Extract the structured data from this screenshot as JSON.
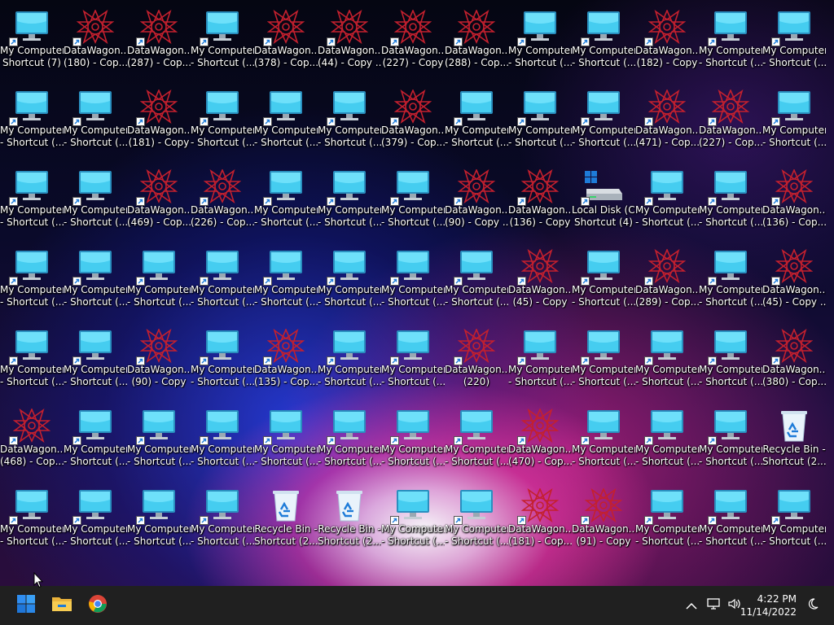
{
  "colors": {
    "taskbar": "#202020",
    "monitor": "#3cc4e8",
    "datawagon": "#c0202c",
    "accent": "#1e7bd8"
  },
  "desktop": {
    "icons": [
      {
        "type": "monitor",
        "line1": "My Computer",
        "line2": "Shortcut (7)",
        "shortcut": true
      },
      {
        "type": "datawagon",
        "line1": "DataWagon...",
        "line2": "(180) - Cop...",
        "shortcut": true
      },
      {
        "type": "datawagon",
        "line1": "DataWagon...",
        "line2": "(287) - Cop...",
        "shortcut": true
      },
      {
        "type": "monitor",
        "line1": "My Computer",
        "line2": "- Shortcut (...",
        "shortcut": true
      },
      {
        "type": "datawagon",
        "line1": "DataWagon...",
        "line2": "(378) - Cop...",
        "shortcut": true
      },
      {
        "type": "datawagon",
        "line1": "DataWagon...",
        "line2": "(44) - Copy ...",
        "shortcut": true
      },
      {
        "type": "datawagon",
        "line1": "DataWagon...",
        "line2": "(227) - Copy",
        "shortcut": true
      },
      {
        "type": "datawagon",
        "line1": "DataWagon...",
        "line2": "(288) - Cop...",
        "shortcut": true
      },
      {
        "type": "monitor",
        "line1": "My Computer",
        "line2": "- Shortcut (...",
        "shortcut": true
      },
      {
        "type": "monitor",
        "line1": "My Computer",
        "line2": "- Shortcut (...",
        "shortcut": true
      },
      {
        "type": "datawagon",
        "line1": "DataWagon...",
        "line2": "(182) - Copy",
        "shortcut": true
      },
      {
        "type": "monitor",
        "line1": "My Computer",
        "line2": "- Shortcut (...",
        "shortcut": true
      },
      {
        "type": "monitor",
        "line1": "My Computer",
        "line2": "- Shortcut (...",
        "shortcut": true
      },
      {
        "type": "monitor",
        "line1": "My Computer",
        "line2": "- Shortcut (...",
        "shortcut": true
      },
      {
        "type": "monitor",
        "line1": "My Computer",
        "line2": "- Shortcut (...",
        "shortcut": true
      },
      {
        "type": "datawagon",
        "line1": "DataWagon...",
        "line2": "(181) - Copy",
        "shortcut": true
      },
      {
        "type": "monitor",
        "line1": "My Computer",
        "line2": "- Shortcut (...",
        "shortcut": true
      },
      {
        "type": "monitor",
        "line1": "My Computer",
        "line2": "- Shortcut (...",
        "shortcut": true
      },
      {
        "type": "monitor",
        "line1": "My Computer",
        "line2": "- Shortcut (...",
        "shortcut": true
      },
      {
        "type": "datawagon",
        "line1": "DataWagon...",
        "line2": "(379) - Cop...",
        "shortcut": true
      },
      {
        "type": "monitor",
        "line1": "My Computer",
        "line2": "- Shortcut (...",
        "shortcut": true
      },
      {
        "type": "monitor",
        "line1": "My Computer",
        "line2": "- Shortcut (...",
        "shortcut": true
      },
      {
        "type": "monitor",
        "line1": "My Computer",
        "line2": "- Shortcut (...",
        "shortcut": true
      },
      {
        "type": "datawagon",
        "line1": "DataWagon...",
        "line2": "(471) - Cop...",
        "shortcut": true
      },
      {
        "type": "datawagon",
        "line1": "DataWagon...",
        "line2": "(227) - Cop...",
        "shortcut": true
      },
      {
        "type": "monitor",
        "line1": "My Computer",
        "line2": "- Shortcut (...",
        "shortcut": true
      },
      {
        "type": "monitor",
        "line1": "My Computer",
        "line2": "- Shortcut (...",
        "shortcut": true
      },
      {
        "type": "monitor",
        "line1": "My Computer",
        "line2": "- Shortcut (...",
        "shortcut": true
      },
      {
        "type": "datawagon",
        "line1": "DataWagon...",
        "line2": "(469) - Cop...",
        "shortcut": true
      },
      {
        "type": "datawagon",
        "line1": "DataWagon...",
        "line2": "(226) - Cop...",
        "shortcut": true
      },
      {
        "type": "monitor",
        "line1": "My Computer",
        "line2": "- Shortcut (...",
        "shortcut": true
      },
      {
        "type": "monitor",
        "line1": "My Computer",
        "line2": "- Shortcut (...",
        "shortcut": true
      },
      {
        "type": "monitor",
        "line1": "My Computer",
        "line2": "- Shortcut (...",
        "shortcut": true
      },
      {
        "type": "datawagon",
        "line1": "DataWagon...",
        "line2": "(90) - Copy ...",
        "shortcut": true
      },
      {
        "type": "datawagon",
        "line1": "DataWagon...",
        "line2": "(136) - Copy",
        "shortcut": true
      },
      {
        "type": "disk",
        "line1": "Local Disk (C)",
        "line2": "Shortcut (4)",
        "shortcut": true
      },
      {
        "type": "monitor",
        "line1": "My Computer",
        "line2": "- Shortcut (...",
        "shortcut": true
      },
      {
        "type": "monitor",
        "line1": "My Computer",
        "line2": "- Shortcut (...",
        "shortcut": true
      },
      {
        "type": "datawagon",
        "line1": "DataWagon...",
        "line2": "(136) - Cop...",
        "shortcut": true
      },
      {
        "type": "monitor",
        "line1": "My Computer",
        "line2": "- Shortcut (...",
        "shortcut": true
      },
      {
        "type": "monitor",
        "line1": "My Computer",
        "line2": "- Shortcut (...",
        "shortcut": true
      },
      {
        "type": "monitor",
        "line1": "My Computer",
        "line2": "- Shortcut (...",
        "shortcut": true
      },
      {
        "type": "monitor",
        "line1": "My Computer",
        "line2": "- Shortcut (...",
        "shortcut": true
      },
      {
        "type": "monitor",
        "line1": "My Computer",
        "line2": "- Shortcut (...",
        "shortcut": true
      },
      {
        "type": "monitor",
        "line1": "My Computer",
        "line2": "- Shortcut (...",
        "shortcut": true
      },
      {
        "type": "monitor",
        "line1": "My Computer",
        "line2": "- Shortcut (...",
        "shortcut": true
      },
      {
        "type": "monitor",
        "line1": "My Computer",
        "line2": "- Shortcut (...",
        "shortcut": true
      },
      {
        "type": "datawagon",
        "line1": "DataWagon...",
        "line2": "(45) - Copy",
        "shortcut": true
      },
      {
        "type": "monitor",
        "line1": "My Computer",
        "line2": "- Shortcut (...",
        "shortcut": true
      },
      {
        "type": "datawagon",
        "line1": "DataWagon...",
        "line2": "(289) - Cop...",
        "shortcut": true
      },
      {
        "type": "monitor",
        "line1": "My Computer",
        "line2": "- Shortcut (...",
        "shortcut": true
      },
      {
        "type": "datawagon",
        "line1": "DataWagon...",
        "line2": "(45) - Copy ...",
        "shortcut": true
      },
      {
        "type": "monitor",
        "line1": "My Computer",
        "line2": "- Shortcut (...",
        "shortcut": true
      },
      {
        "type": "monitor",
        "line1": "My Computer",
        "line2": "- Shortcut (...",
        "shortcut": true
      },
      {
        "type": "datawagon",
        "line1": "DataWagon...",
        "line2": "(90) - Copy",
        "shortcut": true
      },
      {
        "type": "monitor",
        "line1": "My Computer",
        "line2": "- Shortcut (...",
        "shortcut": true
      },
      {
        "type": "datawagon",
        "line1": "DataWagon...",
        "line2": "(135) - Cop...",
        "shortcut": true
      },
      {
        "type": "monitor",
        "line1": "My Computer",
        "line2": "- Shortcut (...",
        "shortcut": true
      },
      {
        "type": "monitor",
        "line1": "My Computer",
        "line2": "- Shortcut (...",
        "shortcut": true
      },
      {
        "type": "datawagon",
        "line1": "DataWagon...",
        "line2": "(220)",
        "shortcut": true
      },
      {
        "type": "monitor",
        "line1": "My Computer",
        "line2": "- Shortcut (...",
        "shortcut": true
      },
      {
        "type": "monitor",
        "line1": "My Computer",
        "line2": "- Shortcut (...",
        "shortcut": true
      },
      {
        "type": "monitor",
        "line1": "My Computer",
        "line2": "- Shortcut (...",
        "shortcut": true
      },
      {
        "type": "monitor",
        "line1": "My Computer",
        "line2": "- Shortcut (...",
        "shortcut": true
      },
      {
        "type": "datawagon",
        "line1": "DataWagon...",
        "line2": "(380) - Cop...",
        "shortcut": true
      },
      {
        "type": "datawagon",
        "line1": "DataWagon...",
        "line2": "(468) - Cop...",
        "shortcut": true
      },
      {
        "type": "monitor",
        "line1": "My Computer",
        "line2": "- Shortcut (...",
        "shortcut": true
      },
      {
        "type": "monitor",
        "line1": "My Computer",
        "line2": "- Shortcut (...",
        "shortcut": true
      },
      {
        "type": "monitor",
        "line1": "My Computer",
        "line2": "- Shortcut (...",
        "shortcut": true
      },
      {
        "type": "monitor",
        "line1": "My Computer",
        "line2": "- Shortcut (...",
        "shortcut": true
      },
      {
        "type": "monitor",
        "line1": "My Computer",
        "line2": "- Shortcut (...",
        "shortcut": true
      },
      {
        "type": "monitor",
        "line1": "My Computer",
        "line2": "- Shortcut (...",
        "shortcut": true
      },
      {
        "type": "monitor",
        "line1": "My Computer",
        "line2": "- Shortcut (...",
        "shortcut": true
      },
      {
        "type": "datawagon",
        "line1": "DataWagon...",
        "line2": "(470) - Cop...",
        "shortcut": true
      },
      {
        "type": "monitor",
        "line1": "My Computer",
        "line2": "- Shortcut (...",
        "shortcut": true
      },
      {
        "type": "monitor",
        "line1": "My Computer",
        "line2": "- Shortcut (...",
        "shortcut": true
      },
      {
        "type": "monitor",
        "line1": "My Computer",
        "line2": "- Shortcut (...",
        "shortcut": true
      },
      {
        "type": "recycle",
        "line1": "Recycle Bin -",
        "line2": "Shortcut (2...",
        "shortcut": false
      },
      {
        "type": "monitor",
        "line1": "My Computer",
        "line2": "- Shortcut (...",
        "shortcut": true
      },
      {
        "type": "monitor",
        "line1": "My Computer",
        "line2": "- Shortcut (...",
        "shortcut": true
      },
      {
        "type": "monitor",
        "line1": "My Computer",
        "line2": "- Shortcut (...",
        "shortcut": true
      },
      {
        "type": "monitor",
        "line1": "My Computer",
        "line2": "- Shortcut (...",
        "shortcut": true
      },
      {
        "type": "recycle",
        "line1": "Recycle Bin -",
        "line2": "Shortcut (2...",
        "shortcut": false
      },
      {
        "type": "recycle",
        "line1": "Recycle Bin -",
        "line2": "Shortcut (2...",
        "shortcut": false
      },
      {
        "type": "monitor",
        "line1": "My Computer",
        "line2": "- Shortcut (...",
        "shortcut": true
      },
      {
        "type": "monitor",
        "line1": "My Computer",
        "line2": "- Shortcut (...",
        "shortcut": true
      },
      {
        "type": "datawagon",
        "line1": "DataWagon...",
        "line2": "(181) - Cop...",
        "shortcut": true
      },
      {
        "type": "datawagon",
        "line1": "DataWagon...",
        "line2": "(91) - Copy",
        "shortcut": true
      },
      {
        "type": "monitor",
        "line1": "My Computer",
        "line2": "- Shortcut (...",
        "shortcut": true
      },
      {
        "type": "monitor",
        "line1": "My Computer",
        "line2": "- Shortcut (...",
        "shortcut": true
      },
      {
        "type": "monitor",
        "line1": "My Computer",
        "line2": "- Shortcut (...",
        "shortcut": true
      }
    ]
  },
  "taskbar": {
    "apps": [
      {
        "name": "start-icon"
      },
      {
        "name": "file-explorer-icon"
      },
      {
        "name": "chrome-icon"
      }
    ],
    "tray": {
      "icons": [
        "chevron-up-icon",
        "network-icon",
        "volume-icon"
      ],
      "time": "4:22 PM",
      "date": "11/14/2022",
      "notification_icon": "moon-icon"
    }
  }
}
